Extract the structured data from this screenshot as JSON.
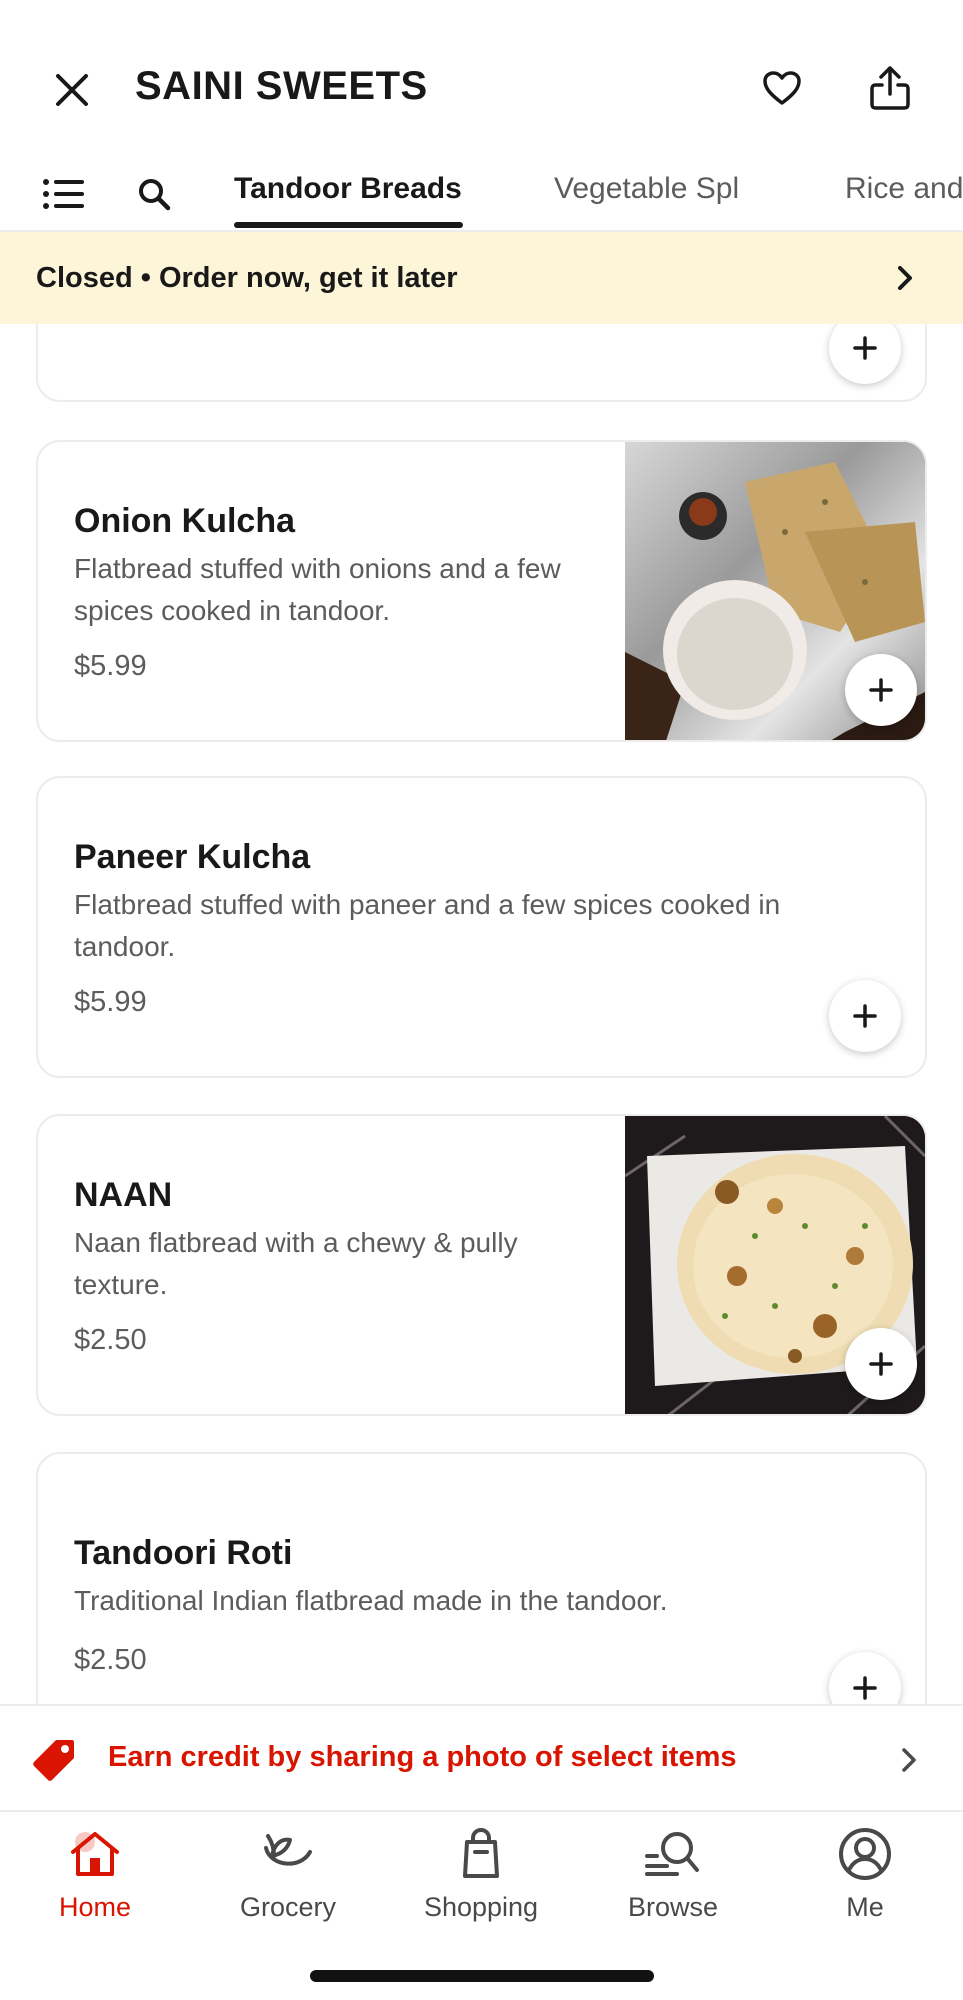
{
  "header": {
    "store_name": "SAINI SWEETS"
  },
  "tabs": {
    "items": [
      {
        "label": "Tandoor Breads",
        "active": true
      },
      {
        "label": "Vegetable Spl",
        "active": false
      },
      {
        "label": "Rice and",
        "active": false
      }
    ]
  },
  "banner": {
    "text": "Closed • Order now, get it later"
  },
  "menu_items": [
    {
      "name": "Onion Kulcha",
      "description": "Flatbread stuffed with onions and a few spices cooked in tandoor.",
      "price": "$5.99",
      "has_image": true
    },
    {
      "name": "Paneer Kulcha",
      "description": "Flatbread stuffed with paneer and a few spices cooked in tandoor.",
      "price": "$5.99",
      "has_image": false
    },
    {
      "name": "NAAN",
      "description": "Naan flatbread with a chewy & pully texture.",
      "price": "$2.50",
      "has_image": true
    },
    {
      "name": "Tandoori Roti",
      "description": "Traditional Indian flatbread made in the tandoor.",
      "price": "$2.50",
      "has_image": false
    }
  ],
  "promo": {
    "text": "Earn credit by sharing a photo of select items"
  },
  "bottom_nav": {
    "items": [
      {
        "label": "Home",
        "icon": "home-icon",
        "active": true
      },
      {
        "label": "Grocery",
        "icon": "grocery-icon",
        "active": false
      },
      {
        "label": "Shopping",
        "icon": "shopping-bag-icon",
        "active": false
      },
      {
        "label": "Browse",
        "icon": "browse-icon",
        "active": false
      },
      {
        "label": "Me",
        "icon": "profile-icon",
        "active": false
      }
    ]
  },
  "colors": {
    "brand_red": "#d91400",
    "banner_bg": "#fdf5d8",
    "text_primary": "#191919",
    "text_secondary": "#5c5c5c"
  }
}
